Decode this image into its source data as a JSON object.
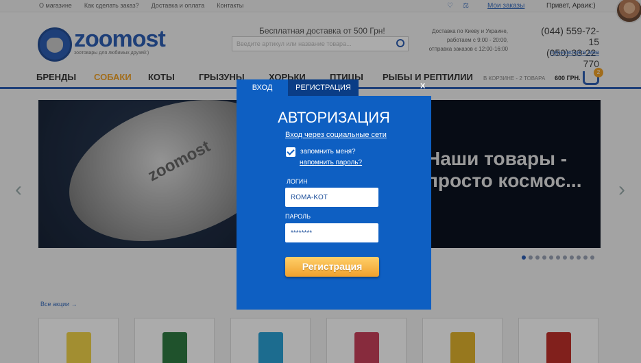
{
  "topbar": {
    "links": [
      "О магазине",
      "Как сделать заказ?",
      "Доставка и оплата",
      "Контакты"
    ],
    "orders": "Мои заказы",
    "hello": "Привет, Араик:)",
    "icons": [
      "heart-icon",
      "scales-icon"
    ]
  },
  "header": {
    "logo": "zoomost",
    "logo_sub": "зоотовары для любимых друзей:)",
    "free_delivery": "Бесплатная доставка от 500 Грн!",
    "search_placeholder": "Введите артикул или название товара...",
    "delivery_lines": [
      "Доставка по Киеву и Украине,",
      "работаем с 9:00 - 20:00,",
      "отправка заказов с 12:00-16:00"
    ],
    "phones": [
      "(044) 559-72-15",
      "(050) 33-22-770"
    ],
    "callback": "перезвоните мне"
  },
  "nav": {
    "items": [
      "БРЕНДЫ",
      "СОБАКИ",
      "КОТЫ",
      "ГРЫЗУНЫ",
      "ХОРЬКИ",
      "ПТИЦЫ",
      "РЫБЫ И РЕПТИЛИИ"
    ],
    "active": "СОБАКИ",
    "cart_text": "В КОРЗИНЕ - 2 ТОВАРА",
    "cart_total": "600 ГРН.",
    "cart_count": "2"
  },
  "banner": {
    "rocket_text": "zoomost",
    "headline": [
      "Наши товары -",
      "просто космос..."
    ]
  },
  "slider_dots": 11,
  "all_sales": "Все акции →",
  "product_colors": [
    "#f2d44a",
    "#2f7b42",
    "#2aa1d6",
    "#c9405b",
    "#e2b32e",
    "#c0302b"
  ],
  "modal": {
    "tab_login": "ВХОД",
    "tab_register": "РЕГИСТРАЦИЯ",
    "close": "X",
    "title": "АВТОРИЗАЦИЯ",
    "social_login": "Вход через социальные сети",
    "remember": "запомнить меня?",
    "forgot": "напомнить пароль?",
    "login_label": "ЛОГИН",
    "login_value": "ROMA-KOT",
    "password_label": "ПАРОЛЬ",
    "password_value": "********",
    "submit": "Регистрация"
  }
}
